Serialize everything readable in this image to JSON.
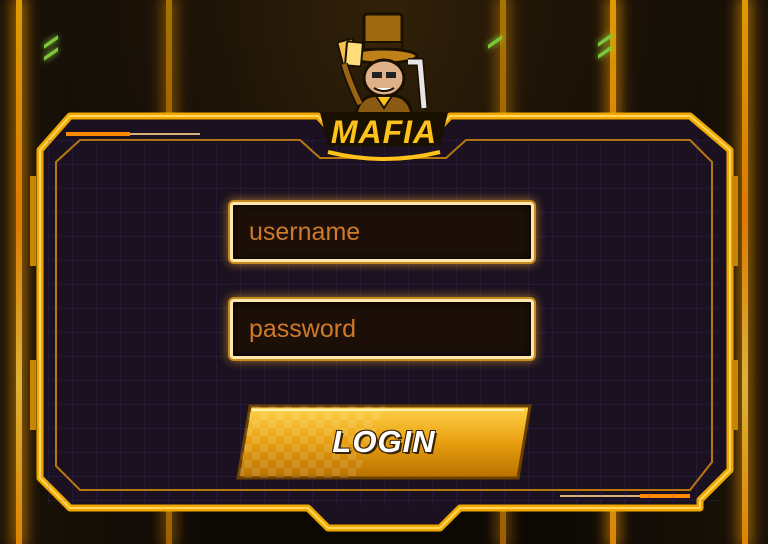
{
  "logo": {
    "text": "MAFIA",
    "icon": "mafia-mascot-icon"
  },
  "form": {
    "username_placeholder": "username",
    "password_placeholder": "password",
    "login_label": "LOGIN"
  },
  "colors": {
    "accent_gold": "#ffc21a",
    "frame_gold": "#f0a800",
    "panel_bg": "#1c1224",
    "placeholder": "#cf7a2a"
  }
}
